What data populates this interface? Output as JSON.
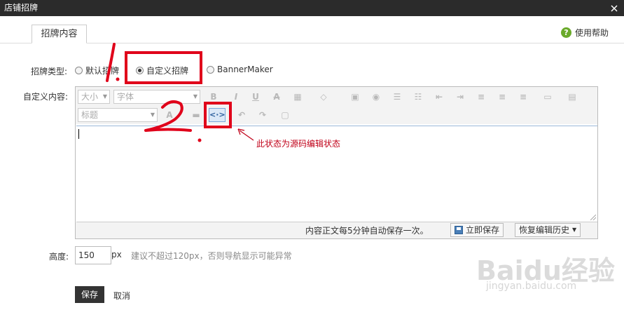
{
  "window": {
    "title": "店铺招牌"
  },
  "tab": {
    "label": "招牌内容"
  },
  "help": {
    "label": "使用帮助",
    "icon": "?"
  },
  "type_row": {
    "label": "招牌类型:",
    "options": [
      {
        "label": "默认招牌",
        "selected": false
      },
      {
        "label": "自定义招牌",
        "selected": true
      },
      {
        "label": "BannerMaker",
        "selected": false
      }
    ]
  },
  "content_row": {
    "label": "自定义内容:"
  },
  "toolbar": {
    "size_select": "大小",
    "font_select": "字体",
    "heading_select": "标题",
    "bold": "B",
    "italic": "I",
    "underline": "U",
    "strike": "A",
    "source_icon": "<·>"
  },
  "editor": {
    "autosave_text": "内容正文每5分钟自动保存一次。",
    "save_now": "立即保存",
    "history": "恢复编辑历史"
  },
  "height_row": {
    "label": "高度:",
    "value": "150",
    "unit": "px",
    "hint": "建议不超过120px，否则导航显示可能异常"
  },
  "actions": {
    "save": "保存",
    "cancel": "取消"
  },
  "annotations": {
    "note": "此状态为源码编辑状态",
    "step1": "1.",
    "step2": "2.",
    "color": "#e0001a"
  },
  "watermark": {
    "brand": "Baidu经验",
    "url": "jingyan.baidu.com"
  }
}
